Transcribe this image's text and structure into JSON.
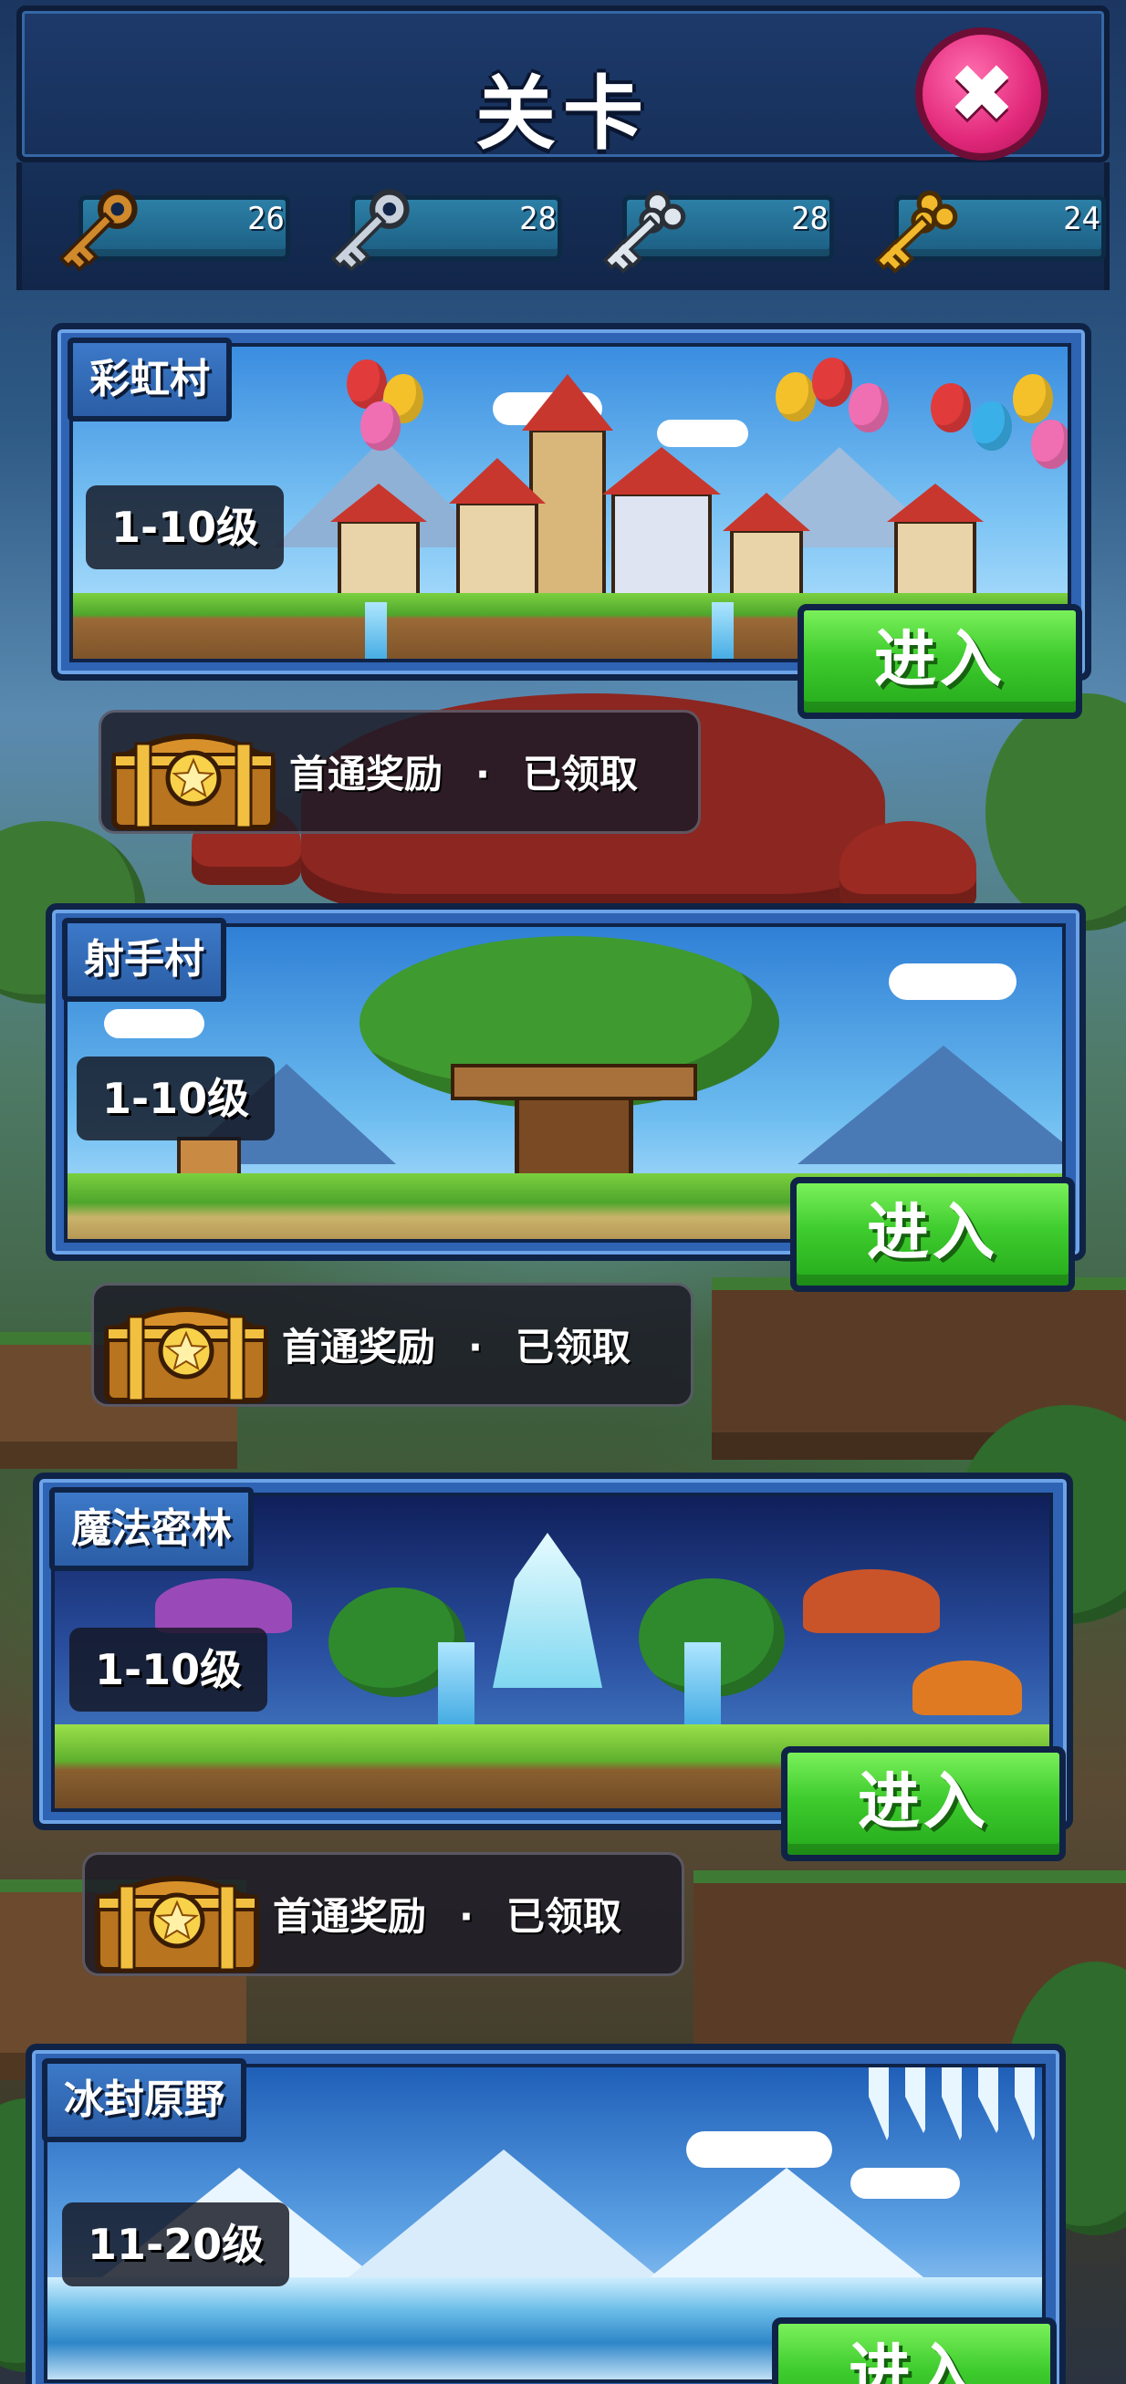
{
  "header": {
    "title": "关卡",
    "close_icon": "close-x-icon"
  },
  "keys": [
    {
      "icon": "bronze-key-icon",
      "count": "26",
      "color": "#d08a2c"
    },
    {
      "icon": "silver-key-icon",
      "count": "28",
      "color": "#c9d2dc"
    },
    {
      "icon": "ornate-silver-key-icon",
      "count": "28",
      "color": "#dfe6ee"
    },
    {
      "icon": "gold-key-icon",
      "count": "24",
      "color": "#f1b92b"
    }
  ],
  "levels": [
    {
      "name": "彩虹村",
      "range": "1-10级",
      "enter_label": "进入",
      "reward": {
        "label": "首通奖励",
        "separator": "·",
        "status": "已领取"
      },
      "scene": "balloon-village"
    },
    {
      "name": "射手村",
      "range": "1-10级",
      "enter_label": "进入",
      "reward": {
        "label": "首通奖励",
        "separator": "·",
        "status": "已领取"
      },
      "scene": "tree-house-village"
    },
    {
      "name": "魔法密林",
      "range": "1-10级",
      "enter_label": "进入",
      "reward": {
        "label": "首通奖励",
        "separator": "·",
        "status": "已领取"
      },
      "scene": "magic-forest"
    },
    {
      "name": "冰封原野",
      "range": "11-20级",
      "enter_label": "进入",
      "scene": "frozen-plains"
    }
  ],
  "colors": {
    "enter_button": "#3fcc2e",
    "close_button": "#e2287a",
    "card_frame": "#2f63b3",
    "header_bg": "#1d3a6b"
  }
}
